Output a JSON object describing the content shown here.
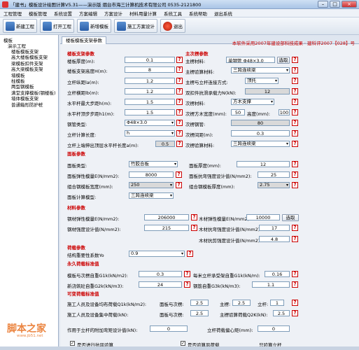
{
  "window": {
    "title": "「建书」模板设计绘图计算V5.31——演示版 烟台市海三计算机技术有限公司 0535-2121800"
  },
  "menu": [
    "工程管理",
    "模板管理",
    "系统设置",
    "方案编辑",
    "方案设计",
    "材料用量计算",
    "系统工具",
    "系统帮助",
    "退出系统"
  ],
  "toolbar": {
    "new": "新建工程",
    "open": "打开工程",
    "add_template": "新增模板",
    "design": "施工方案设计",
    "exit": "退出"
  },
  "tree": {
    "root": "模板",
    "project": "演示工程",
    "items": [
      "楼板模板支架",
      "高大楼板模板支架",
      "梁模板扣件支架",
      "高大梁模板支架",
      "墙模板",
      "柱模板",
      "两型钢模板",
      "满堂支撑模板(钢楼板)",
      "墙体模板支架",
      "普通箱形防护桩"
    ]
  },
  "tab": "楼板模板支架参数",
  "banner": "本软件采用2007年建设部科技成果 · 建科评2007【028】号",
  "sections": {
    "support": "楼板支架参数",
    "secondary": "主次楞参数",
    "panel": "面板参数",
    "material": "材料参数",
    "load": "荷载参数",
    "permanent": "永久荷载标准值",
    "variable": "可变荷载标准值",
    "wind": "风荷载参数"
  },
  "support": {
    "thickness_label": "楼板厚度(m):",
    "thickness": "0.1",
    "height_label": "楼板支架高度H(m):",
    "height": "8",
    "la_label": "立杆纵距la(m):",
    "la": "1.2",
    "lb_label": "立杆横距lb(m):",
    "lb": "1.2",
    "step_label": "水平杆最大步距h(m):",
    "step": "1.5",
    "step_end_label": "水平杆顶步步距h1(m):",
    "step_end": "1.5",
    "pipe_label": "钢管类型:",
    "pipe": "Φ48×3.0",
    "calc_label": "立杆计算长度:",
    "calc": "h",
    "ext_label": "立杆上端伸出顶层水平杆长度a(m):",
    "ext": "0.5"
  },
  "secondary": {
    "main_mat_label": "主楞材料:",
    "main_mat": "单钢管 Φ48×3.0",
    "pick_btn": "选取",
    "main_layout_label": "主楞验算材料:",
    "main_layout": "三跨连续梁",
    "conn_label": "主楞与立杆连接方式:",
    "conn": "顶托",
    "capacity_label": "双扣件抗滑承载力N(kN):",
    "capacity": "12",
    "sec_mat_label": "次楞材料:",
    "sec_mat": "方木支撑",
    "size_label": "次楞方木宽度(mm):",
    "width": "50",
    "height_label": "高度(mm):",
    "height": "100",
    "pipe_label": "次楞钢管:",
    "pipe": "80",
    "spacing_label": "次楞间距(m):",
    "spacing": "0.3",
    "calc_label": "次楞验算材料:",
    "calc": "三跨连续梁"
  },
  "panel": {
    "type_label": "面板类型:",
    "type": "竹胶合板",
    "thick_label": "面板厚度(mm):",
    "thick": "12",
    "E_label": "面板弹性模量E(N/mm2):",
    "E": "8000",
    "f_label": "面板抗弯强度设计值(N/mm2):",
    "f": "25",
    "combo_w_label": "组合钢模板宽度(mm):",
    "combo_w": "250",
    "combo_t_label": "组合钢模板厚度(mm):",
    "combo_t": "2.75",
    "calc_label": "面板计算模型:",
    "calc": "三跨连续梁"
  },
  "material": {
    "steel_E_label": "钢材弹性模量E(N/mm2):",
    "steel_E": "206000",
    "wood_E_label": "木材弹性模量E(N/mm2):",
    "wood_E": "10000",
    "pick_btn": "选取",
    "steel_f_label": "钢材强度设计值(N/mm2):",
    "steel_f": "215",
    "wood_f_label": "木材抗弯强度设计值(N/mm2):",
    "wood_f": "17",
    "wood_v_label": "木材抗剪强度设计值(N/mm2):",
    "wood_v": "4.8"
  },
  "load": {
    "factor_label": "结构重要性系数Yo",
    "factor": "0.9"
  },
  "permanent": {
    "g1_label": "模板与次楞自重G1k(kN/m2):",
    "g1": "0.3",
    "g1b_label": "每米立杆承受架自重G1k(kN/m):",
    "g1b": "0.16",
    "g2_label": "新浇筑砼自重G2k(kN/m3):",
    "g2": "24",
    "g3_label": "钢筋自重G3k(kN/m3):",
    "g3": "1.1"
  },
  "variable": {
    "q1_label": "施工人员及设备均布荷载Q1k(kN/m2):",
    "panel_label": "面板与次楞:",
    "q1a": "2.5",
    "main_label": "主楞:",
    "q1b": "2.5",
    "pole_label": "立杆:",
    "q1c": "1",
    "q2_label": "施工人员及设备集中荷载(kN):",
    "q2_panel_label": "面板与次楞:",
    "q2a": "2.5",
    "q2_main_label": "主楞验算荷载Q2K(kN):",
    "q2b": "2.5"
  },
  "wind": {
    "wind_label": "作用于立杆的附加弯矩设计值(kN):",
    "wind": "0",
    "ecc_label": "立杆荷载偏心矩(mm):",
    "ecc": "0",
    "check_a": "是否进行抗风验算",
    "check_b": "是否验算风荷载",
    "check_c": "只验算立杆"
  },
  "watermark": "脚本之家",
  "watermark_sub": "www.jb51.net"
}
